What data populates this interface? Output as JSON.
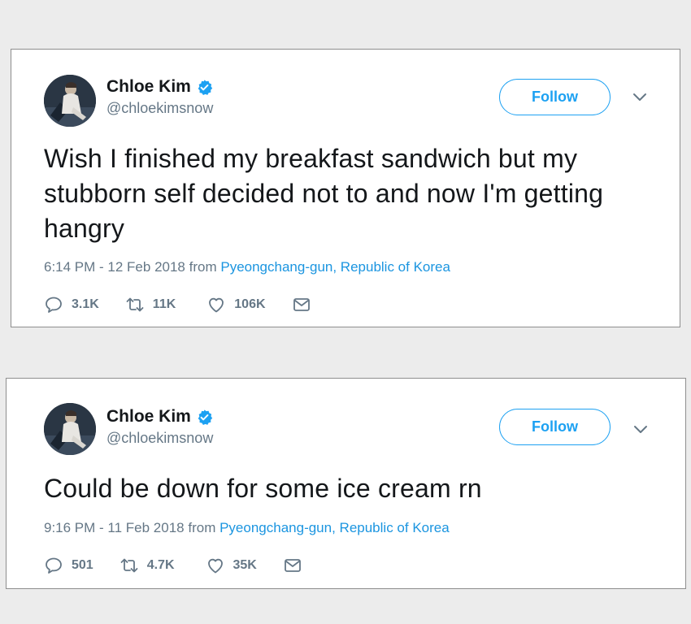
{
  "colors": {
    "accent": "#1da1f2",
    "link": "#1b95e0",
    "secondary_text": "#657786",
    "primary_text": "#14171a",
    "page_background": "#ececec"
  },
  "tweets": [
    {
      "author_name": "Chloe Kim",
      "handle": "@chloekimsnow",
      "verified_icon": "verified-badge-icon",
      "follow_label": "Follow",
      "text": "Wish I finished my breakfast sandwich but my stubborn self decided not to and now I'm getting hangry",
      "timestamp": "6:14 PM - 12 Feb 2018",
      "from_label": "from",
      "location": "Pyeongchang-gun, Republic of Korea",
      "replies": "3.1K",
      "retweets": "11K",
      "likes": "106K"
    },
    {
      "author_name": "Chloe Kim",
      "handle": "@chloekimsnow",
      "verified_icon": "verified-badge-icon",
      "follow_label": "Follow",
      "text": "Could be down for some ice cream rn",
      "timestamp": "9:16 PM - 11 Feb 2018",
      "from_label": "from",
      "location": "Pyeongchang-gun, Republic of Korea",
      "replies": "501",
      "retweets": "4.7K",
      "likes": "35K"
    }
  ]
}
